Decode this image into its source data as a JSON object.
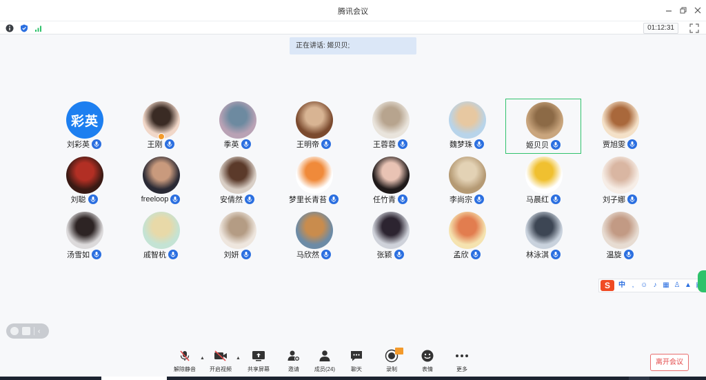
{
  "app": {
    "title": "腾讯会议"
  },
  "status": {
    "timer": "01:12:31"
  },
  "speaking": {
    "text": "正在讲话: 姬贝贝;"
  },
  "participants": [
    {
      "name": "刘彩英",
      "avatar_text": "彩英",
      "avatar_kind": "text"
    },
    {
      "name": "王刚",
      "avatar_colors": [
        "#f1d7c8",
        "#3a2b24"
      ],
      "host": true
    },
    {
      "name": "季英",
      "avatar_colors": [
        "#b9a2b5",
        "#6d8aa0"
      ]
    },
    {
      "name": "王明帝",
      "avatar_colors": [
        "#7b4a2e",
        "#d8b493"
      ]
    },
    {
      "name": "王蓉蓉",
      "avatar_colors": [
        "#e9e4dc",
        "#b7a48e"
      ]
    },
    {
      "name": "魏梦珠",
      "avatar_colors": [
        "#b8d4ea",
        "#e7c8a1"
      ]
    },
    {
      "name": "姬贝贝",
      "avatar_colors": [
        "#c9a57d",
        "#8c6a46"
      ],
      "active": true
    },
    {
      "name": "贾旭雯",
      "avatar_colors": [
        "#f4e1c8",
        "#a9683b"
      ]
    },
    {
      "name": "刘聪",
      "avatar_colors": [
        "#3a1a14",
        "#b22f24"
      ]
    },
    {
      "name": "freeloop",
      "avatar_colors": [
        "#2a2a35",
        "#c99a7d"
      ]
    },
    {
      "name": "安倩然",
      "avatar_colors": [
        "#d9cfc6",
        "#5b3a2a"
      ]
    },
    {
      "name": "梦里长青苔",
      "avatar_colors": [
        "#ffffff",
        "#f08a3a"
      ]
    },
    {
      "name": "任竹青",
      "avatar_colors": [
        "#1f1a1a",
        "#e9c3b4"
      ]
    },
    {
      "name": "李尚宗",
      "avatar_colors": [
        "#b59a74",
        "#e3d2b5"
      ]
    },
    {
      "name": "马晨红",
      "avatar_colors": [
        "#ffffff",
        "#f0c030"
      ]
    },
    {
      "name": "刘子娜",
      "avatar_colors": [
        "#f6ede6",
        "#d9b6a2"
      ]
    },
    {
      "name": "汤雪如",
      "avatar_colors": [
        "#dcdadb",
        "#2d2424"
      ]
    },
    {
      "name": "戚智杭",
      "avatar_colors": [
        "#c4e3d4",
        "#e8d9a8"
      ]
    },
    {
      "name": "刘妍",
      "avatar_colors": [
        "#eee6de",
        "#b49c84"
      ]
    },
    {
      "name": "马欣然",
      "avatar_colors": [
        "#6c8ba6",
        "#c98c4d"
      ]
    },
    {
      "name": "张颍",
      "avatar_colors": [
        "#cfd2da",
        "#2c2430"
      ]
    },
    {
      "name": "孟欣",
      "avatar_colors": [
        "#f5e3b0",
        "#e27d4f"
      ]
    },
    {
      "name": "林泳淇",
      "avatar_colors": [
        "#c9d2dd",
        "#3d4654"
      ]
    },
    {
      "name": "温旋",
      "avatar_colors": [
        "#e7dcd2",
        "#c29a84"
      ]
    }
  ],
  "ime": {
    "lang": "中"
  },
  "toolbar": {
    "mute": "解除静音",
    "video": "开启视频",
    "share": "共享屏幕",
    "invite": "邀请",
    "members": "成员(24)",
    "chat": "聊天",
    "record": "录制",
    "record_badge": "",
    "emoji": "表情",
    "more": "更多",
    "leave": "离开会议"
  },
  "colors": {
    "accent": "#2b6fe0",
    "active_border": "#2fc26b",
    "leave": "#e34b4b"
  }
}
